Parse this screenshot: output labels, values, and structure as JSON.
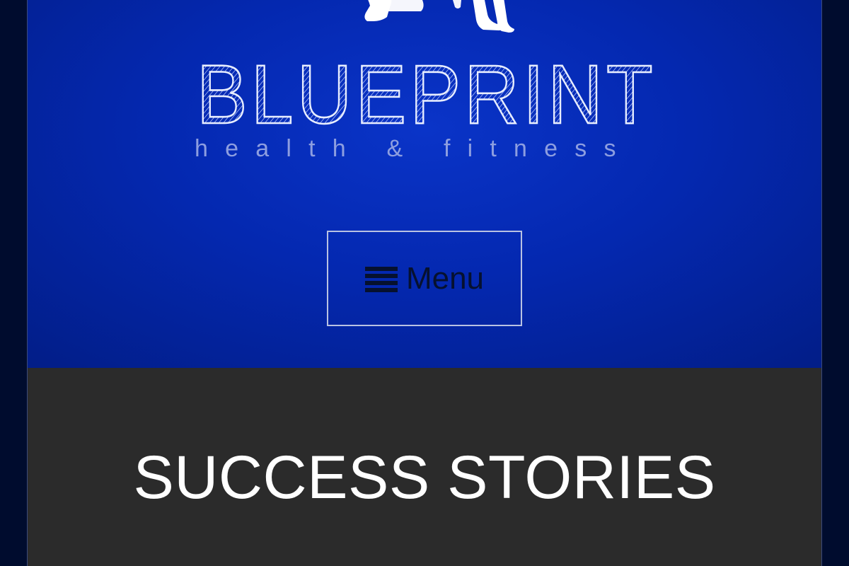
{
  "brand": {
    "logo_text": "BLUEPRINT",
    "tagline": "health & fitness",
    "figure_icon": "athlete-pushup-icon"
  },
  "nav": {
    "menu_label": "Menu",
    "menu_icon": "hamburger-icon"
  },
  "content": {
    "section_title": "SUCCESS STORIES"
  },
  "colors": {
    "outer_background": "#000c2e",
    "hero_blue": "#0a34c8",
    "hero_blue_dark": "#021d86",
    "content_background": "#2b2b2b",
    "menu_text": "#06112f",
    "menu_border": "#b9c2e2",
    "title_text": "#ffffff"
  }
}
